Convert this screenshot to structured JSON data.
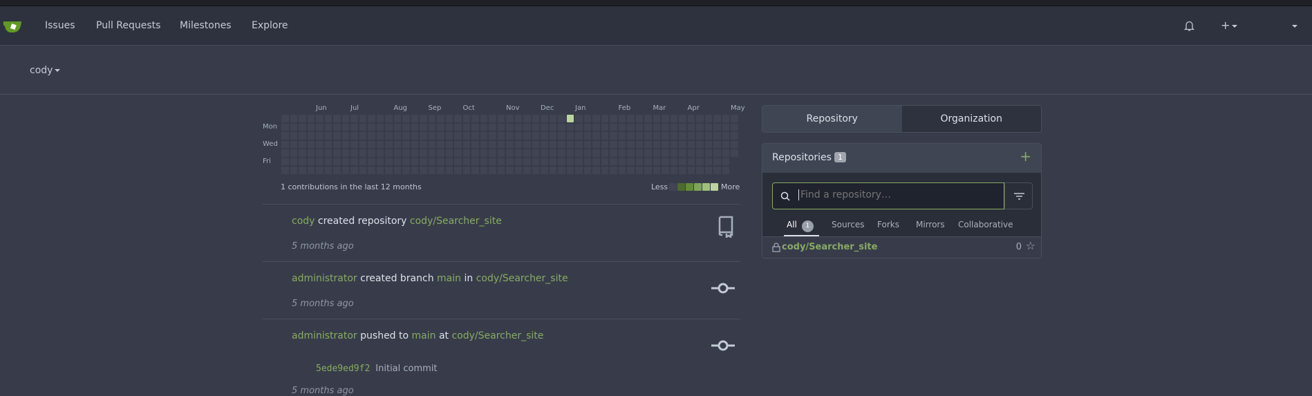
{
  "nav": {
    "items": [
      "Issues",
      "Pull Requests",
      "Milestones",
      "Explore"
    ],
    "icons": [
      "bell-icon",
      "plus-icon"
    ]
  },
  "context_user": "cody",
  "heatmap": {
    "months": [
      {
        "label": "Jun",
        "week": 4
      },
      {
        "label": "Jul",
        "week": 8
      },
      {
        "label": "Aug",
        "week": 13
      },
      {
        "label": "Sep",
        "week": 17
      },
      {
        "label": "Oct",
        "week": 21
      },
      {
        "label": "Nov",
        "week": 26
      },
      {
        "label": "Dec",
        "week": 30
      },
      {
        "label": "Jan",
        "week": 34
      },
      {
        "label": "Feb",
        "week": 39
      },
      {
        "label": "Mar",
        "week": 43
      },
      {
        "label": "Apr",
        "week": 47
      },
      {
        "label": "May",
        "week": 52
      }
    ],
    "days": [
      "Mon",
      "Wed",
      "Fri"
    ],
    "weeks": 53,
    "last_week_days": 5,
    "contributions": [
      {
        "week": 33,
        "day": 0,
        "level": 4
      }
    ],
    "summary": "1 contributions in the last 12 months",
    "less": "Less",
    "more": "More",
    "colors": [
      "#414553",
      "#4c6b2f",
      "#628c3c",
      "#7da55a",
      "#9fc07d",
      "#bcd5a0"
    ]
  },
  "feed": [
    {
      "parts": [
        {
          "t": "cody",
          "link": true
        },
        {
          "t": " created repository "
        },
        {
          "t": "cody/Searcher_site",
          "link": true
        }
      ],
      "time": "5 months ago",
      "icon": "repo-icon"
    },
    {
      "parts": [
        {
          "t": "administrator",
          "link": true
        },
        {
          "t": " created branch "
        },
        {
          "t": "main",
          "link": true
        },
        {
          "t": " in "
        },
        {
          "t": "cody/Searcher_site",
          "link": true
        }
      ],
      "time": "5 months ago",
      "icon": "commit-icon"
    },
    {
      "parts": [
        {
          "t": "administrator",
          "link": true
        },
        {
          "t": " pushed to "
        },
        {
          "t": "main",
          "link": true
        },
        {
          "t": " at "
        },
        {
          "t": "cody/Searcher_site",
          "link": true
        }
      ],
      "commit": {
        "sha": "5ede9ed9f2",
        "message": "Initial commit"
      },
      "time": "5 months ago",
      "icon": "commit-icon"
    }
  ],
  "panel": {
    "tabs": [
      "Repository",
      "Organization"
    ],
    "title": "Repositories",
    "count": "1",
    "search_placeholder": "Find a repository…",
    "filters": [
      "All",
      "Sources",
      "Forks",
      "Mirrors",
      "Collaborative"
    ],
    "all_count": "1",
    "repos": [
      {
        "name": "cody/Searcher_site",
        "stars": "0",
        "private": true
      }
    ]
  }
}
